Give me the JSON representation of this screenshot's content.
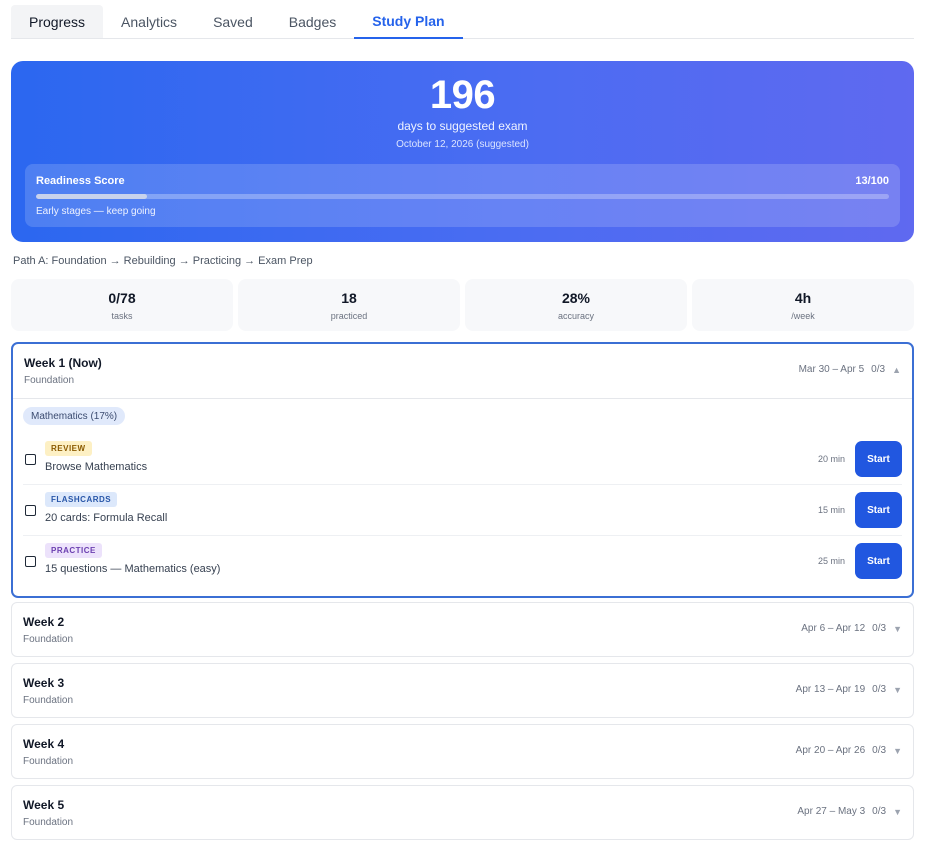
{
  "tabs": [
    "Progress",
    "Analytics",
    "Saved",
    "Badges",
    "Study Plan"
  ],
  "hero": {
    "days": "196",
    "subtitle": "days to suggested exam",
    "date": "October 12, 2026 (suggested)",
    "readiness_label": "Readiness Score",
    "readiness_score": "13/100",
    "readiness_fraction": 0.13,
    "readiness_note": "Early stages — keep going"
  },
  "path": "Path A: Foundation → Rebuilding → Practicing → Exam Prep",
  "stats": [
    {
      "value": "0/78",
      "label": "tasks"
    },
    {
      "value": "18",
      "label": "practiced"
    },
    {
      "value": "28%",
      "label": "accuracy"
    },
    {
      "value": "4h",
      "label": "/week"
    }
  ],
  "weeks": [
    {
      "title": "Week 1 (Now)",
      "phase": "Foundation",
      "range": "Mar 30 – Apr 5",
      "progress": "0/3",
      "chevron": "▲"
    },
    {
      "title": "Week 2",
      "phase": "Foundation",
      "range": "Apr 6 – Apr 12",
      "progress": "0/3",
      "chevron": "▼"
    },
    {
      "title": "Week 3",
      "phase": "Foundation",
      "range": "Apr 13 – Apr 19",
      "progress": "0/3",
      "chevron": "▼"
    },
    {
      "title": "Week 4",
      "phase": "Foundation",
      "range": "Apr 20 – Apr 26",
      "progress": "0/3",
      "chevron": "▼"
    },
    {
      "title": "Week 5",
      "phase": "Foundation",
      "range": "Apr 27 – May 3",
      "progress": "0/3",
      "chevron": "▼"
    }
  ],
  "week1": {
    "subject": "Mathematics (17%)",
    "tasks": [
      {
        "type": "REVIEW",
        "text": "Browse Mathematics",
        "minutes": "20 min",
        "action": "Start"
      },
      {
        "type": "FLASHCARDS",
        "text": "20 cards: Formula Recall",
        "minutes": "15 min",
        "action": "Start"
      },
      {
        "type": "PRACTICE",
        "text": "15 questions — Mathematics (easy)",
        "minutes": "25 min",
        "action": "Start"
      }
    ]
  }
}
